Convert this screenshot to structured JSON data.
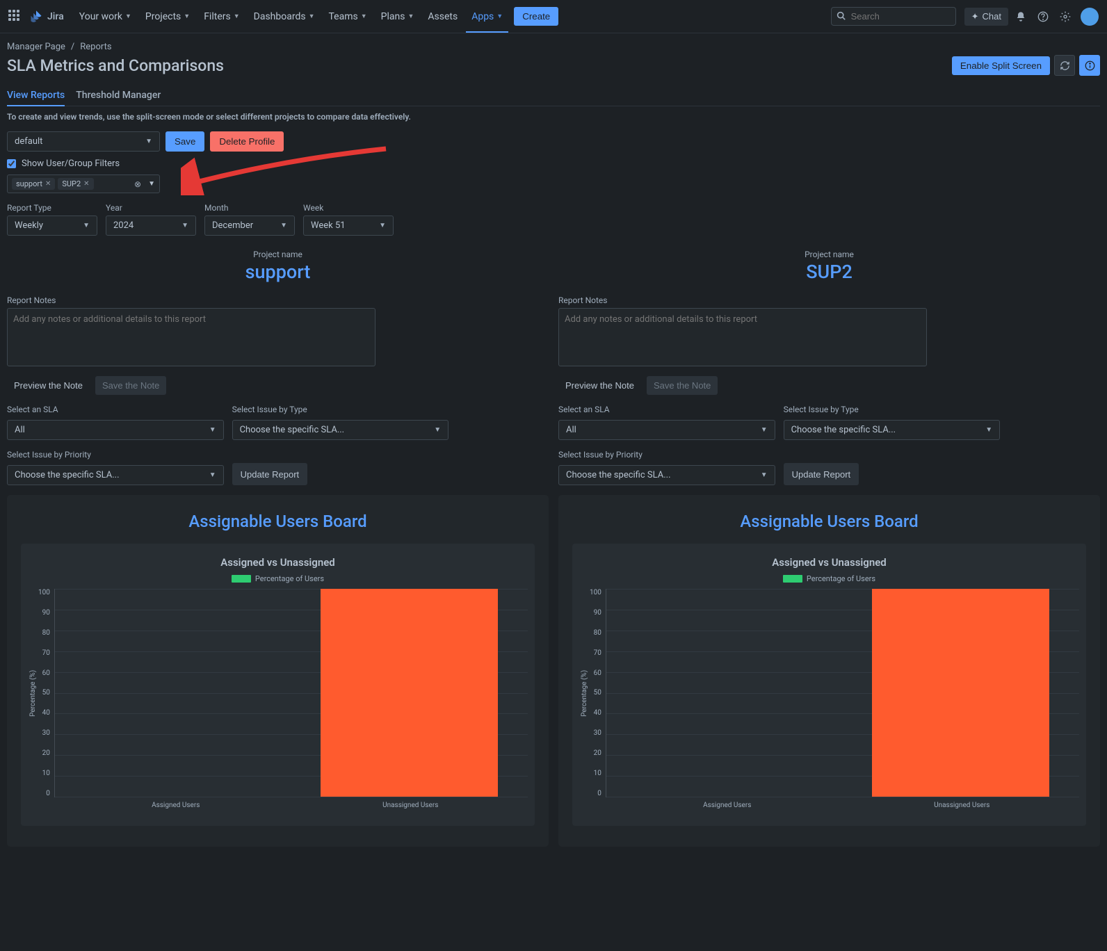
{
  "nav": {
    "logo_text": "Jira",
    "items": [
      "Your work",
      "Projects",
      "Filters",
      "Dashboards",
      "Teams",
      "Plans",
      "Assets",
      "Apps"
    ],
    "active_index": 7,
    "create": "Create",
    "search_placeholder": "Search",
    "chat": "Chat"
  },
  "breadcrumb": {
    "parent": "Manager Page",
    "current": "Reports"
  },
  "page_title": "SLA Metrics and Comparisons",
  "actions": {
    "enable_split": "Enable Split Screen"
  },
  "tabs": {
    "view": "View Reports",
    "threshold": "Threshold Manager"
  },
  "helper": "To create and view trends, use the split-screen mode or select different projects to compare data effectively.",
  "profile": {
    "default": "default",
    "save": "Save",
    "delete": "Delete Profile"
  },
  "show_filters": {
    "label": "Show User/Group Filters",
    "checked": true
  },
  "tags": [
    "support",
    "SUP2"
  ],
  "report_type": {
    "label": "Report Type",
    "value": "Weekly"
  },
  "year": {
    "label": "Year",
    "value": "2024"
  },
  "month": {
    "label": "Month",
    "value": "December"
  },
  "week": {
    "label": "Week",
    "value": "Week 51"
  },
  "columns": [
    {
      "project_label": "Project name",
      "project_name": "support",
      "notes_label": "Report Notes",
      "notes_placeholder": "Add any notes or additional details to this report",
      "preview": "Preview the Note",
      "save_note": "Save the Note",
      "sla_label": "Select an SLA",
      "sla_value": "All",
      "issue_type_label": "Select Issue by Type",
      "issue_type_value": "Choose the specific SLA...",
      "priority_label": "Select Issue by Priority",
      "priority_value": "Choose the specific SLA...",
      "update": "Update Report",
      "board_title": "Assignable Users Board",
      "chart_title": "Assigned vs Unassigned",
      "legend": "Percentage of Users"
    },
    {
      "project_label": "Project name",
      "project_name": "SUP2",
      "notes_label": "Report Notes",
      "notes_placeholder": "Add any notes or additional details to this report",
      "preview": "Preview the Note",
      "save_note": "Save the Note",
      "sla_label": "Select an SLA",
      "sla_value": "All",
      "issue_type_label": "Select Issue by Type",
      "issue_type_value": "Choose the specific SLA...",
      "priority_label": "Select Issue by Priority",
      "priority_value": "Choose the specific SLA...",
      "update": "Update Report",
      "board_title": "Assignable Users Board",
      "chart_title": "Assigned vs Unassigned",
      "legend": "Percentage of Users"
    }
  ],
  "chart_data": [
    {
      "type": "bar",
      "title": "Assigned vs Unassigned",
      "categories": [
        "Assigned Users",
        "Unassigned Users"
      ],
      "series": [
        {
          "name": "Percentage of Users",
          "values": [
            0,
            100
          ]
        }
      ],
      "ylabel": "Percentage (%)",
      "ylim": [
        0,
        100
      ],
      "yticks": [
        0,
        10,
        20,
        30,
        40,
        50,
        60,
        70,
        80,
        90,
        100
      ]
    },
    {
      "type": "bar",
      "title": "Assigned vs Unassigned",
      "categories": [
        "Assigned Users",
        "Unassigned Users"
      ],
      "series": [
        {
          "name": "Percentage of Users",
          "values": [
            0,
            100
          ]
        }
      ],
      "ylabel": "Percentage (%)",
      "ylim": [
        0,
        100
      ],
      "yticks": [
        0,
        10,
        20,
        30,
        40,
        50,
        60,
        70,
        80,
        90,
        100
      ]
    }
  ]
}
